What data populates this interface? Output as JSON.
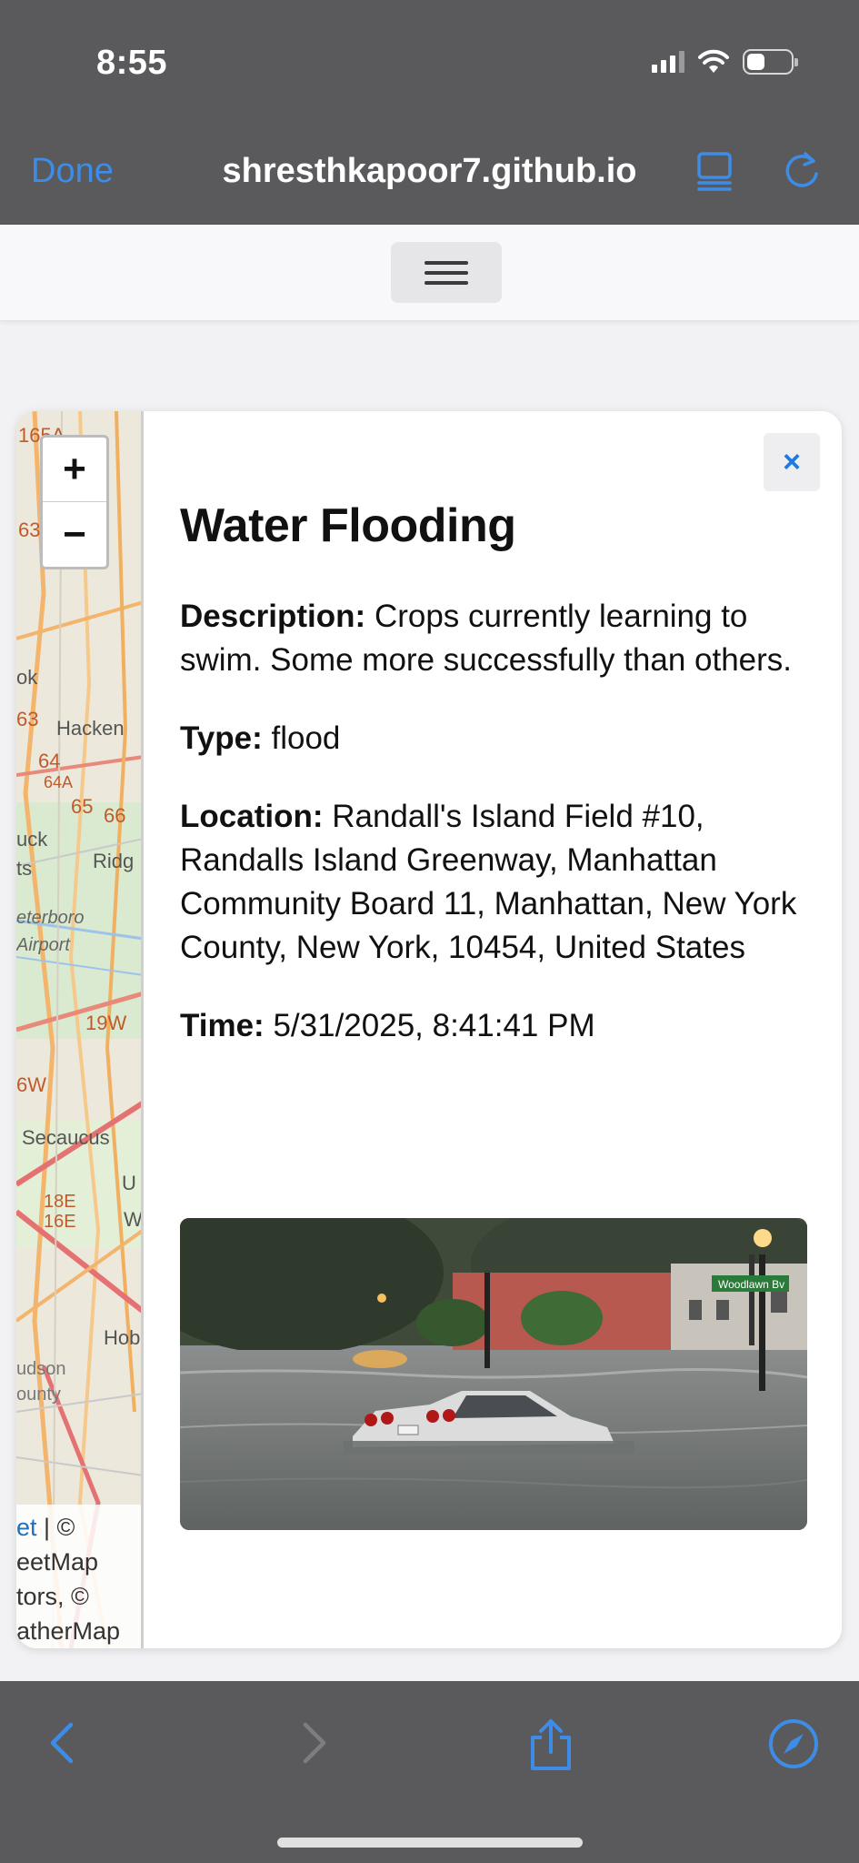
{
  "status_bar": {
    "time": "8:55"
  },
  "browser": {
    "done_label": "Done",
    "url": "shresthkapoor7.github.io",
    "accent_color": "#3d8de8"
  },
  "map": {
    "labels": [
      "165A",
      "63",
      "ok",
      "63",
      "Hacken",
      "64",
      "64A",
      "65",
      "66",
      "uck",
      "ts",
      "Ridg",
      "eterboro",
      "Airport",
      "19W",
      "6W",
      "Secaucus",
      "U",
      "18E",
      "16E",
      "W",
      "Hob",
      "udson",
      "ounty"
    ],
    "zoom_in": "+",
    "zoom_out": "−",
    "attribution": {
      "line1_link": "et",
      "line1_rest": " | ©",
      "line2": "eetMap",
      "line3": "tors, ©",
      "line4": "atherMap"
    }
  },
  "popup": {
    "close_label": "×",
    "title": "Water Flooding",
    "description_label": "Description:",
    "description": "Crops currently learning to swim. Some more successfully than others.",
    "type_label": "Type:",
    "type": "flood",
    "location_label": "Location:",
    "location": "Randall's Island Field #10, Randalls Island Greenway, Manhattan Community Board 11, Manhattan, New York County, New York, 10454, United States",
    "time_label": "Time:",
    "time": "5/31/2025, 8:41:41 PM",
    "photo_sign": "Woodlawn Bv"
  }
}
